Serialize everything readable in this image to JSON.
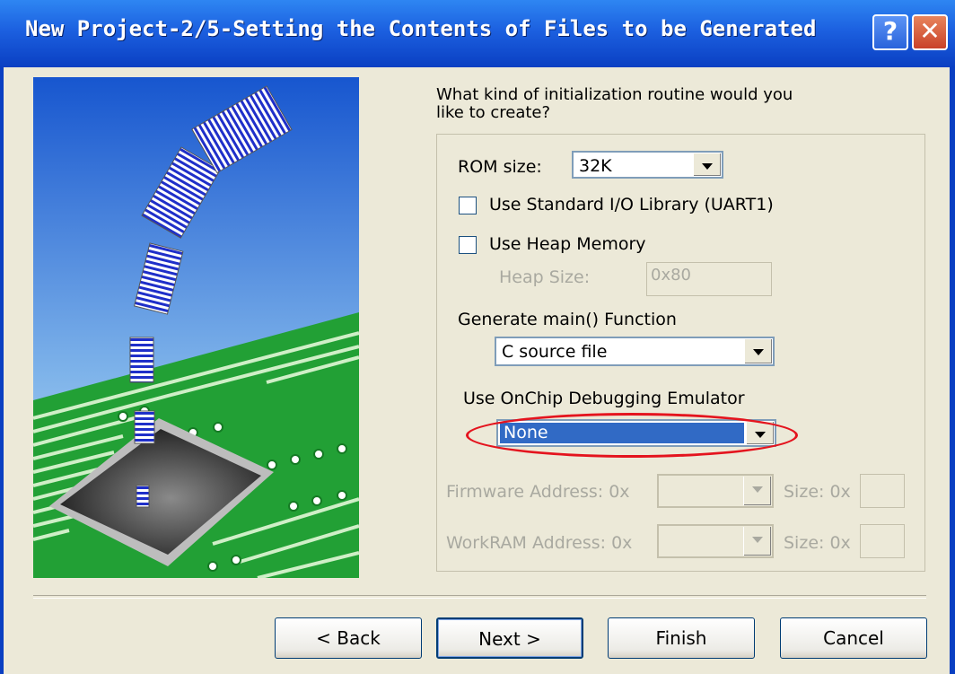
{
  "window": {
    "title": "New Project-2/5-Setting the Contents of Files to be Generated",
    "help_glyph": "?",
    "close_glyph": "✕"
  },
  "question": "What kind of initialization routine would you like to create?",
  "rom": {
    "label": "ROM size:",
    "value": "32K"
  },
  "std_io": {
    "label": "Use Standard I/O Library (UART1)",
    "checked": false
  },
  "heap": {
    "label": "Use Heap Memory",
    "checked": false,
    "size_label": "Heap Size:",
    "size_value": "0x80"
  },
  "main_func": {
    "label": "Generate main() Function",
    "value": "C source file"
  },
  "emulator": {
    "label": "Use OnChip Debugging Emulator",
    "value": "None"
  },
  "firmware": {
    "label": "Firmware Address: 0x",
    "size_label": "Size: 0x"
  },
  "workram": {
    "label": "WorkRAM Address: 0x",
    "size_label": "Size: 0x"
  },
  "buttons": {
    "back": "< Back",
    "next": "Next >",
    "finish": "Finish",
    "cancel": "Cancel"
  },
  "colors": {
    "titlebar": "#0A3FC2",
    "dialog_bg": "#ECE9D8",
    "selection": "#316AC5",
    "annotation": "#E4141E",
    "board": "#22A035"
  },
  "icons": {
    "illustration": "chip-with-flying-documents-illustration"
  }
}
